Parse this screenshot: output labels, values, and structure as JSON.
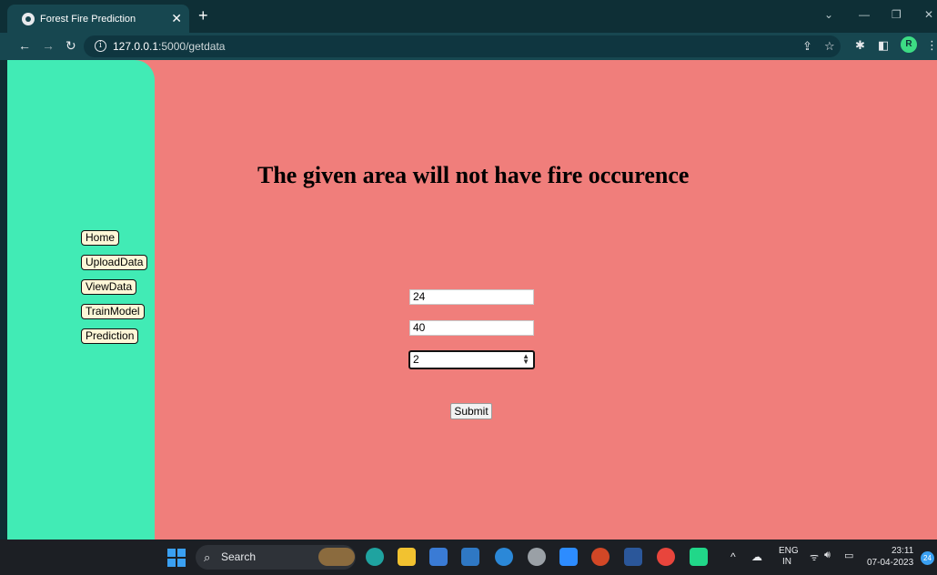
{
  "browser": {
    "tab_title": "Forest Fire Prediction",
    "new_tab_label": "+",
    "url_host": "127.0.0.1",
    "url_path": ":5000/getdata",
    "profile_initial": "R"
  },
  "sidebar": {
    "items": [
      {
        "label": "Home"
      },
      {
        "label": "UploadData"
      },
      {
        "label": "ViewData"
      },
      {
        "label": "TrainModel"
      },
      {
        "label": "Prediction"
      }
    ]
  },
  "main": {
    "result_text": "The given area will not have fire occurence",
    "form": {
      "field1_value": "24",
      "field2_value": "40",
      "select_value": "2",
      "submit_label": "Submit"
    }
  },
  "taskbar": {
    "search_label": "Search",
    "language": "ENG",
    "region": "IN",
    "time": "23:11",
    "date": "07-04-2023",
    "notification_count": "24"
  },
  "colors": {
    "sidebar_bg": "#41ebb5",
    "main_bg": "#f07e7b",
    "nav_button_bg": "#fdf7d7"
  }
}
